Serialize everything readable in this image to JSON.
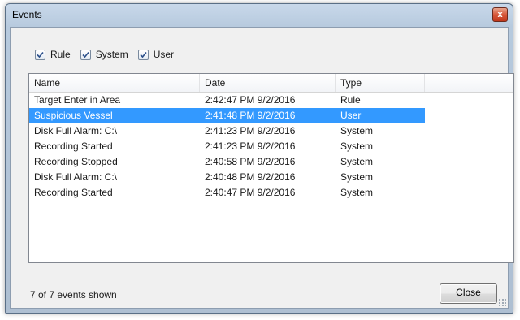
{
  "window": {
    "title": "Events",
    "close_glyph": "x"
  },
  "filters": [
    {
      "label": "Rule",
      "checked": true
    },
    {
      "label": "System",
      "checked": true
    },
    {
      "label": "User",
      "checked": true
    }
  ],
  "table": {
    "columns": [
      "Name",
      "Date",
      "Type"
    ],
    "rows": [
      {
        "name": "Target Enter in Area",
        "date": "2:42:47 PM 9/2/2016",
        "type": "Rule",
        "selected": false
      },
      {
        "name": "Suspicious Vessel",
        "date": "2:41:48 PM 9/2/2016",
        "type": "User",
        "selected": true
      },
      {
        "name": "Disk Full Alarm: C:\\",
        "date": "2:41:23 PM 9/2/2016",
        "type": "System",
        "selected": false
      },
      {
        "name": "Recording Started",
        "date": "2:41:23 PM 9/2/2016",
        "type": "System",
        "selected": false
      },
      {
        "name": "Recording Stopped",
        "date": "2:40:58 PM 9/2/2016",
        "type": "System",
        "selected": false
      },
      {
        "name": "Disk Full Alarm: C:\\",
        "date": "2:40:48 PM 9/2/2016",
        "type": "System",
        "selected": false
      },
      {
        "name": "Recording Started",
        "date": "2:40:47 PM 9/2/2016",
        "type": "System",
        "selected": false
      }
    ]
  },
  "footer": {
    "status": "7 of 7 events shown",
    "close_label": "Close"
  },
  "colors": {
    "selection": "#3399ff",
    "close_button_red": "#c0381c"
  }
}
